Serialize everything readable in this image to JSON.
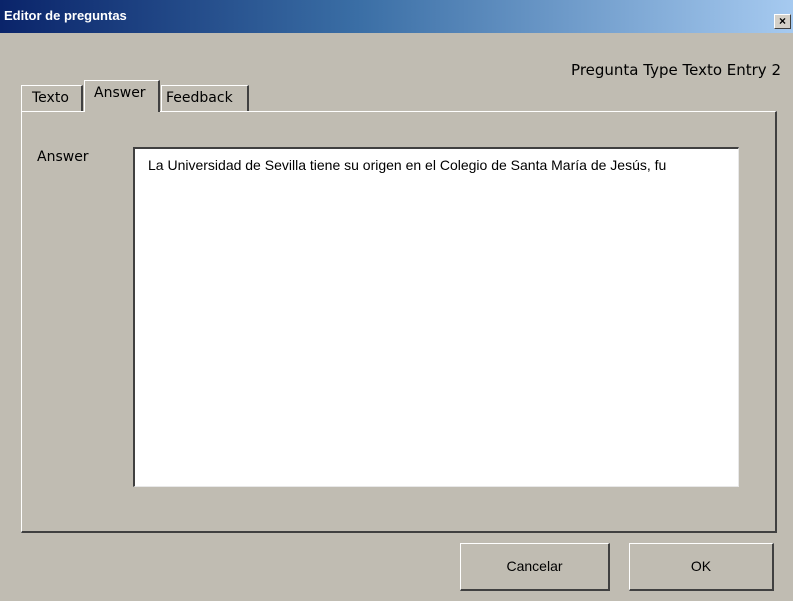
{
  "window": {
    "title": "Editor de preguntas",
    "close_glyph": "×"
  },
  "header": {
    "subtitle": "Pregunta Type Texto Entry 2"
  },
  "tabs": [
    {
      "label": "Texto",
      "active": false
    },
    {
      "label": "Answer",
      "active": true
    },
    {
      "label": "Feedback",
      "active": false
    }
  ],
  "answer": {
    "label": "Answer",
    "value": "La Universidad de Sevilla tiene su origen en el Colegio de Santa María de Jesús, fu"
  },
  "buttons": {
    "cancel": "Cancelar",
    "ok": "OK"
  },
  "icons": {
    "close": "close-icon"
  }
}
